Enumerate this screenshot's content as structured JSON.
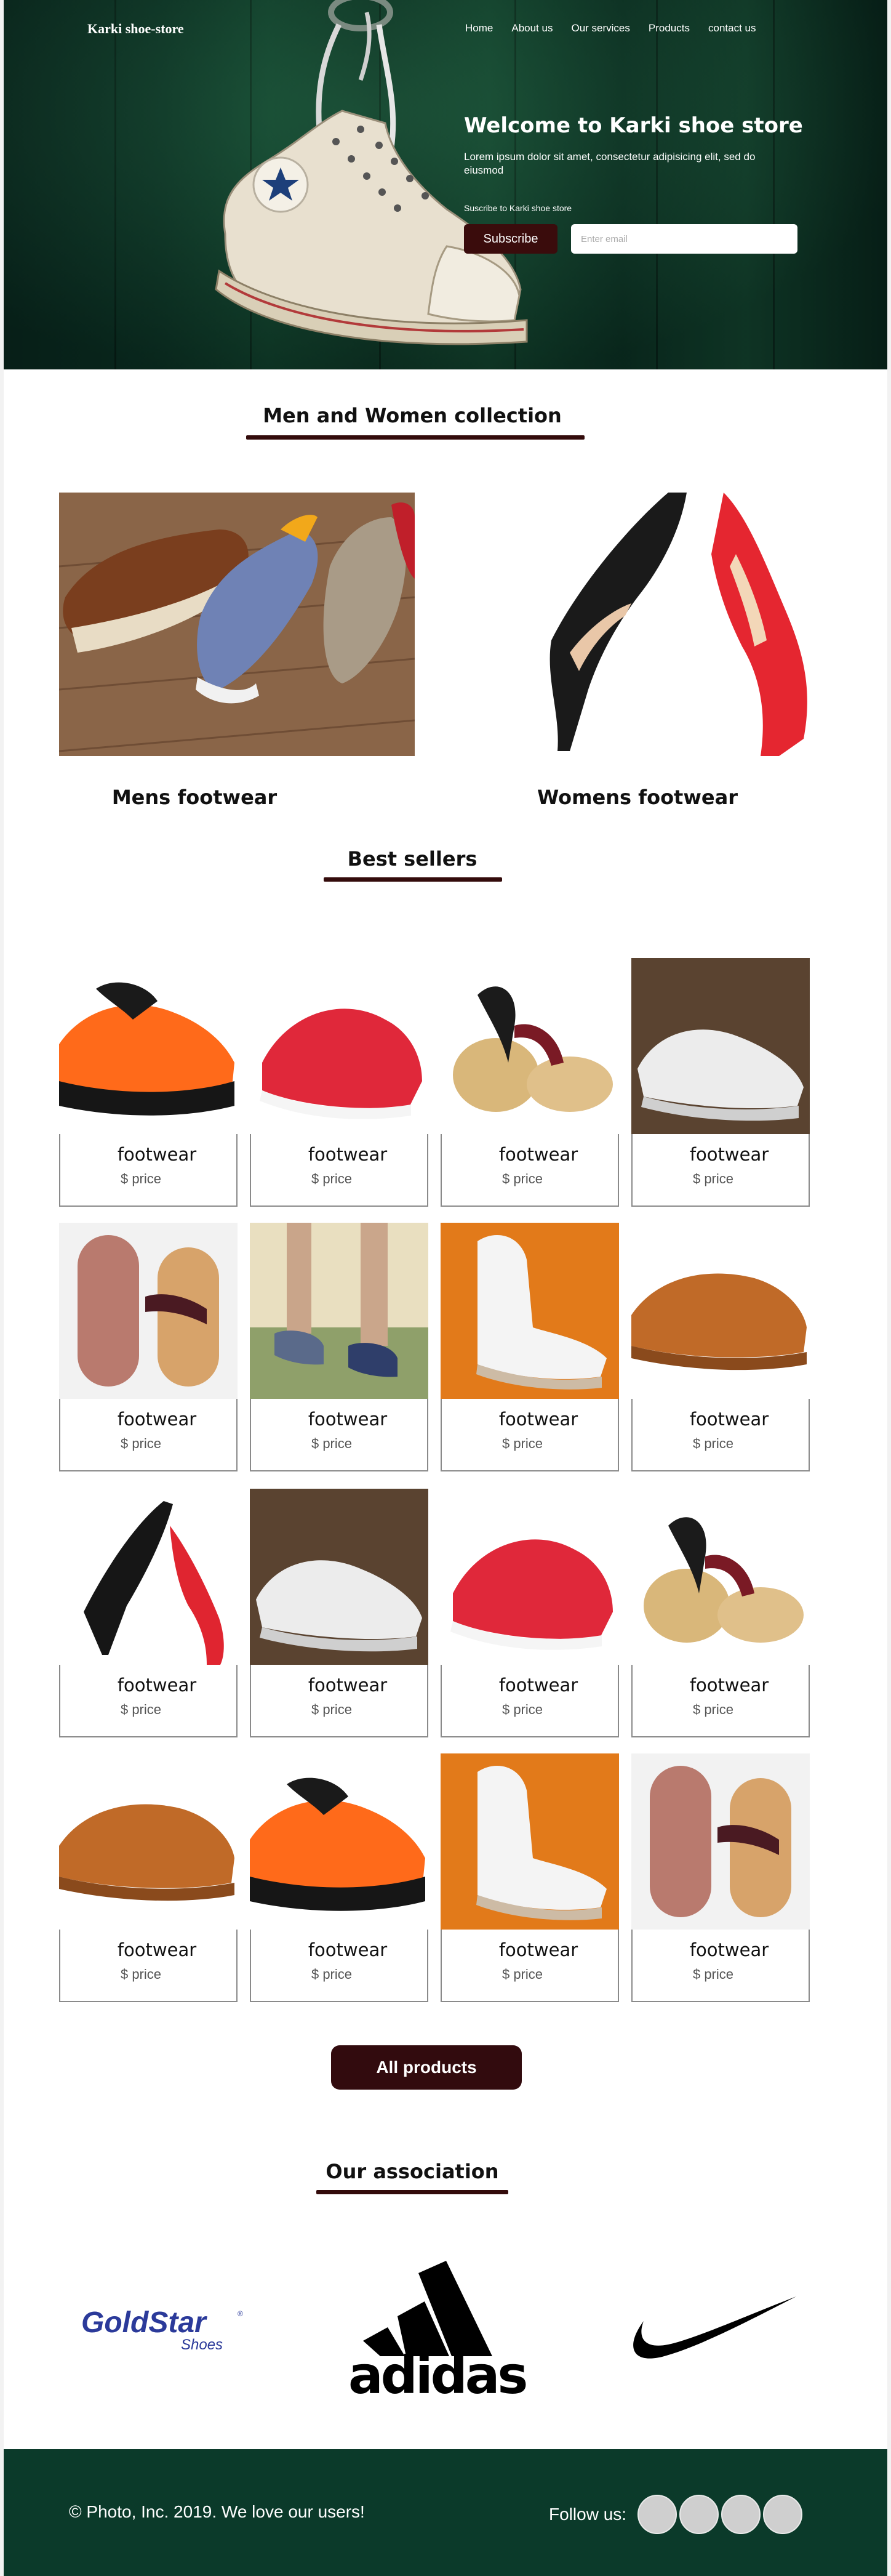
{
  "header": {
    "logo": "Karki shoe-store",
    "nav": [
      "Home",
      "About us",
      "Our services",
      "Products",
      "contact us"
    ]
  },
  "hero": {
    "title": "Welcome to Karki shoe store",
    "description": "Lorem ipsum dolor sit amet, consectetur adipisicing elit, sed do eiusmod",
    "subscribe_text": "Suscribe to  Karki shoe store",
    "subscribe_label": "Subscribe",
    "email_placeholder": "Enter email"
  },
  "collection": {
    "title": "Men and Women collection",
    "mens_label": "Mens footwear",
    "womens_label": "Womens footwear"
  },
  "best_sellers": {
    "title": "Best sellers",
    "products": [
      {
        "name": "footwear",
        "price": "$ price",
        "image": "orange-sneaker"
      },
      {
        "name": "footwear",
        "price": "$ price",
        "image": "red-sneaker"
      },
      {
        "name": "footwear",
        "price": "$ price",
        "image": "sandal"
      },
      {
        "name": "footwear",
        "price": "$ price",
        "image": "white-oxford"
      },
      {
        "name": "footwear",
        "price": "$ price",
        "image": "flip-flop"
      },
      {
        "name": "footwear",
        "price": "$ price",
        "image": "runner-legs"
      },
      {
        "name": "footwear",
        "price": "$ price",
        "image": "white-sneaker-orange-bg"
      },
      {
        "name": "footwear",
        "price": "$ price",
        "image": "tan-shoes"
      },
      {
        "name": "footwear",
        "price": "$ price",
        "image": "heels"
      },
      {
        "name": "footwear",
        "price": "$ price",
        "image": "white-oxford"
      },
      {
        "name": "footwear",
        "price": "$ price",
        "image": "red-sneaker"
      },
      {
        "name": "footwear",
        "price": "$ price",
        "image": "sandal"
      },
      {
        "name": "footwear",
        "price": "$ price",
        "image": "tan-shoes"
      },
      {
        "name": "footwear",
        "price": "$ price",
        "image": "orange-sneaker"
      },
      {
        "name": "footwear",
        "price": "$ price",
        "image": "white-sneaker-orange-bg"
      },
      {
        "name": "footwear",
        "price": "$ price",
        "image": "flip-flop"
      }
    ],
    "all_products_label": "All products"
  },
  "association": {
    "title": "Our association",
    "brands": [
      {
        "name": "GoldStar",
        "sub": "Shoes",
        "mark": "®"
      },
      {
        "name": "adidas"
      },
      {
        "name": "nike-swoosh"
      }
    ]
  },
  "footer": {
    "copyright": "© Photo, Inc. 2019. We love our users!",
    "follow_label": "Follow us:",
    "social_icons": [
      "social-icon-1",
      "social-icon-2",
      "social-icon-3",
      "social-icon-4"
    ]
  },
  "colors": {
    "accent": "#330b0b",
    "footer_bg": "#0b3a2a",
    "hero_bg": "#0f3e2c"
  }
}
